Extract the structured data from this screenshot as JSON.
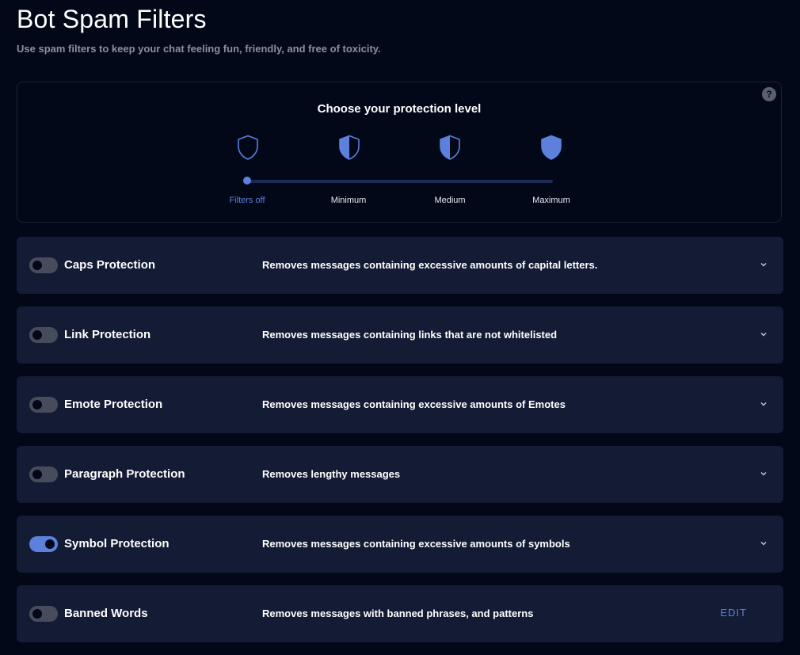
{
  "header": {
    "title": "Bot Spam Filters",
    "subtitle": "Use spam filters to keep your chat feeling fun, friendly, and free of toxicity."
  },
  "protection": {
    "title": "Choose your protection level",
    "help": "?",
    "selected_index": 0,
    "levels": [
      {
        "label": "Filters off",
        "fill": "none"
      },
      {
        "label": "Minimum",
        "fill": "half"
      },
      {
        "label": "Medium",
        "fill": "half"
      },
      {
        "label": "Maximum",
        "fill": "full"
      }
    ]
  },
  "filters": [
    {
      "name": "Caps Protection",
      "description": "Removes messages containing excessive amounts of capital letters.",
      "enabled": false,
      "action": "chevron"
    },
    {
      "name": "Link Protection",
      "description": "Removes messages containing links that are not whitelisted",
      "enabled": false,
      "action": "chevron"
    },
    {
      "name": "Emote Protection",
      "description": "Removes messages containing excessive amounts of Emotes",
      "enabled": false,
      "action": "chevron"
    },
    {
      "name": "Paragraph Protection",
      "description": "Removes lengthy messages",
      "enabled": false,
      "action": "chevron"
    },
    {
      "name": "Symbol Protection",
      "description": "Removes messages containing excessive amounts of symbols",
      "enabled": true,
      "action": "chevron"
    },
    {
      "name": "Banned Words",
      "description": "Removes messages with banned phrases, and patterns",
      "enabled": false,
      "action": "edit",
      "action_label": "EDIT"
    }
  ],
  "colors": {
    "background": "#020818",
    "card": "#141b34",
    "accent": "#5c80db",
    "toggle_off": "#474c5c"
  }
}
